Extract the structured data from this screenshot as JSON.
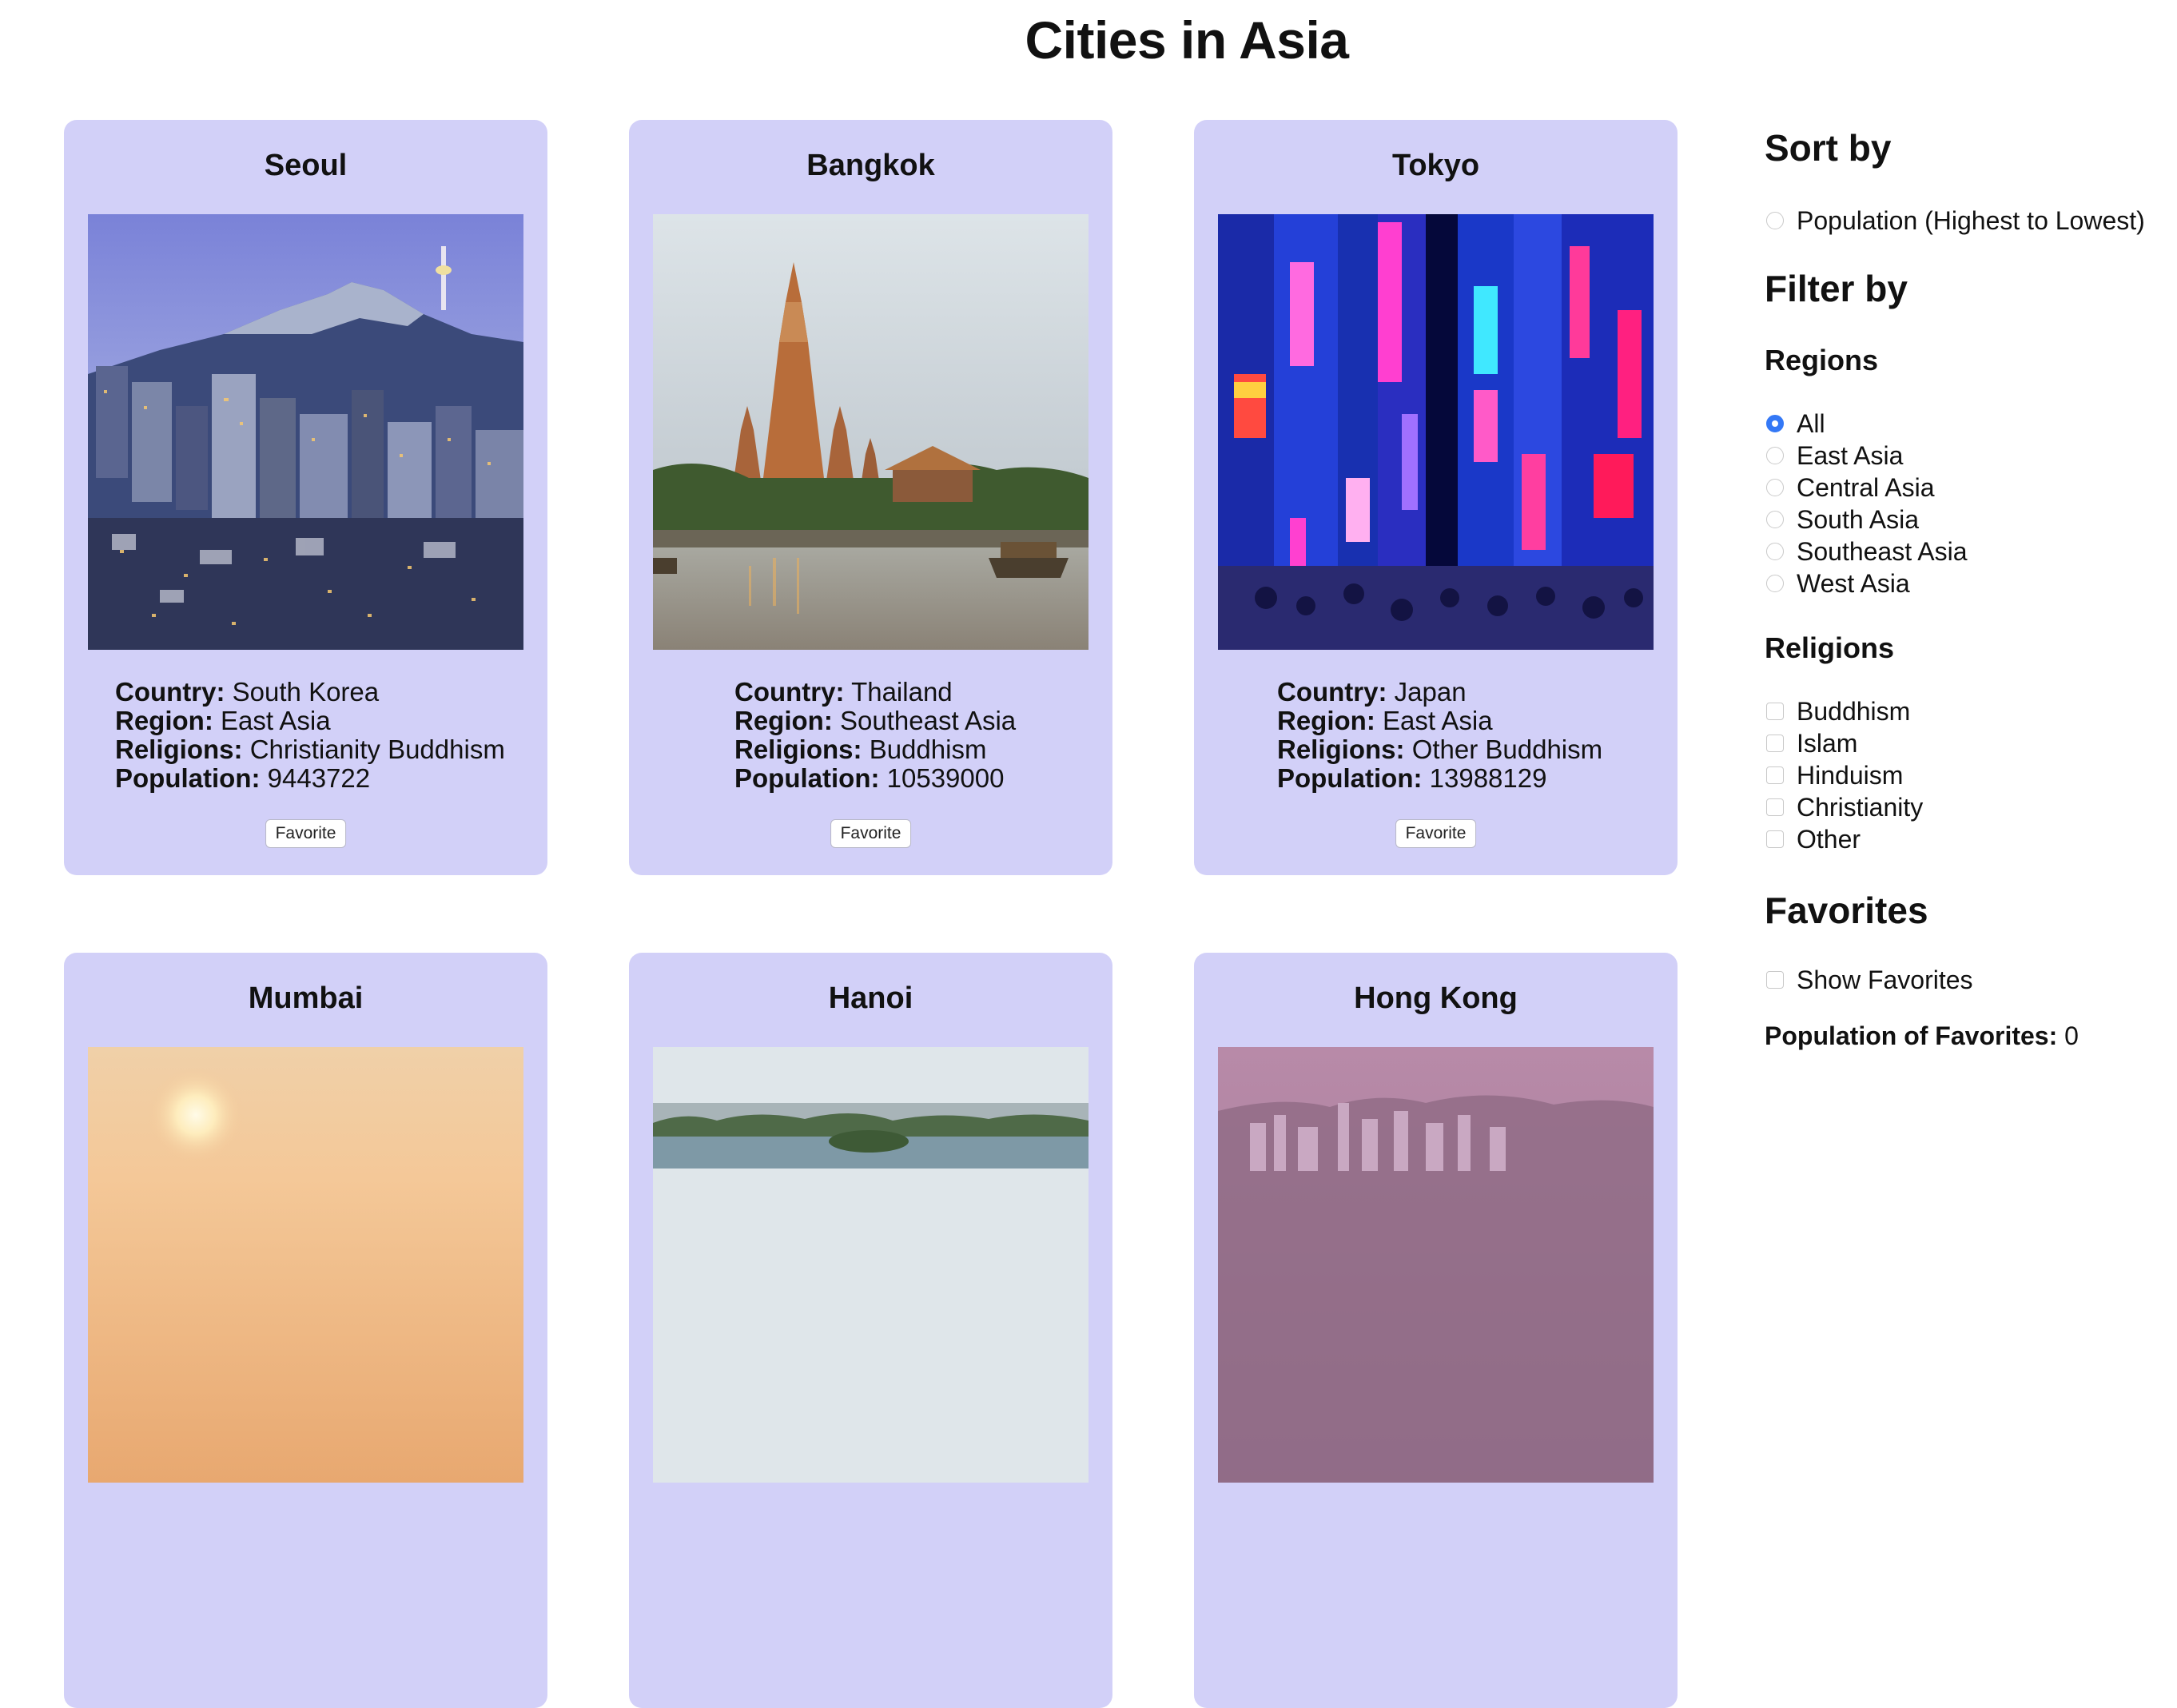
{
  "page": {
    "title": "Cities in Asia"
  },
  "cities": [
    {
      "name": "Seoul",
      "country": "South Korea",
      "region": "East Asia",
      "religions": "Christianity Buddhism",
      "population": "9443722",
      "favorite_label": "Favorite"
    },
    {
      "name": "Bangkok",
      "country": "Thailand",
      "region": "Southeast Asia",
      "religions": "Buddhism",
      "population": "10539000",
      "favorite_label": "Favorite"
    },
    {
      "name": "Tokyo",
      "country": "Japan",
      "region": "East Asia",
      "religions": "Other Buddhism",
      "population": "13988129",
      "favorite_label": "Favorite"
    },
    {
      "name": "Mumbai"
    },
    {
      "name": "Hanoi"
    },
    {
      "name": "Hong Kong"
    }
  ],
  "labels": {
    "country": "Country:",
    "region": "Region:",
    "religions": "Religions:",
    "population": "Population:"
  },
  "sidebar": {
    "sort_heading": "Sort by",
    "sort_options": [
      {
        "label": "Population (Highest to Lowest)",
        "selected": false
      }
    ],
    "filter_heading": "Filter by",
    "regions_heading": "Regions",
    "regions": [
      {
        "label": "All",
        "selected": true
      },
      {
        "label": "East Asia",
        "selected": false
      },
      {
        "label": "Central Asia",
        "selected": false
      },
      {
        "label": "South Asia",
        "selected": false
      },
      {
        "label": "Southeast Asia",
        "selected": false
      },
      {
        "label": "West Asia",
        "selected": false
      }
    ],
    "religions_heading": "Religions",
    "religions": [
      {
        "label": "Buddhism",
        "checked": false
      },
      {
        "label": "Islam",
        "checked": false
      },
      {
        "label": "Hinduism",
        "checked": false
      },
      {
        "label": "Christianity",
        "checked": false
      },
      {
        "label": "Other",
        "checked": false
      }
    ],
    "favorites_heading": "Favorites",
    "show_favorites_label": "Show Favorites",
    "population_favorites_label": "Population of Favorites:",
    "population_favorites_value": "0"
  },
  "colors": {
    "card_bg": "#d2d0f8",
    "radio_selected": "#3478f6"
  }
}
